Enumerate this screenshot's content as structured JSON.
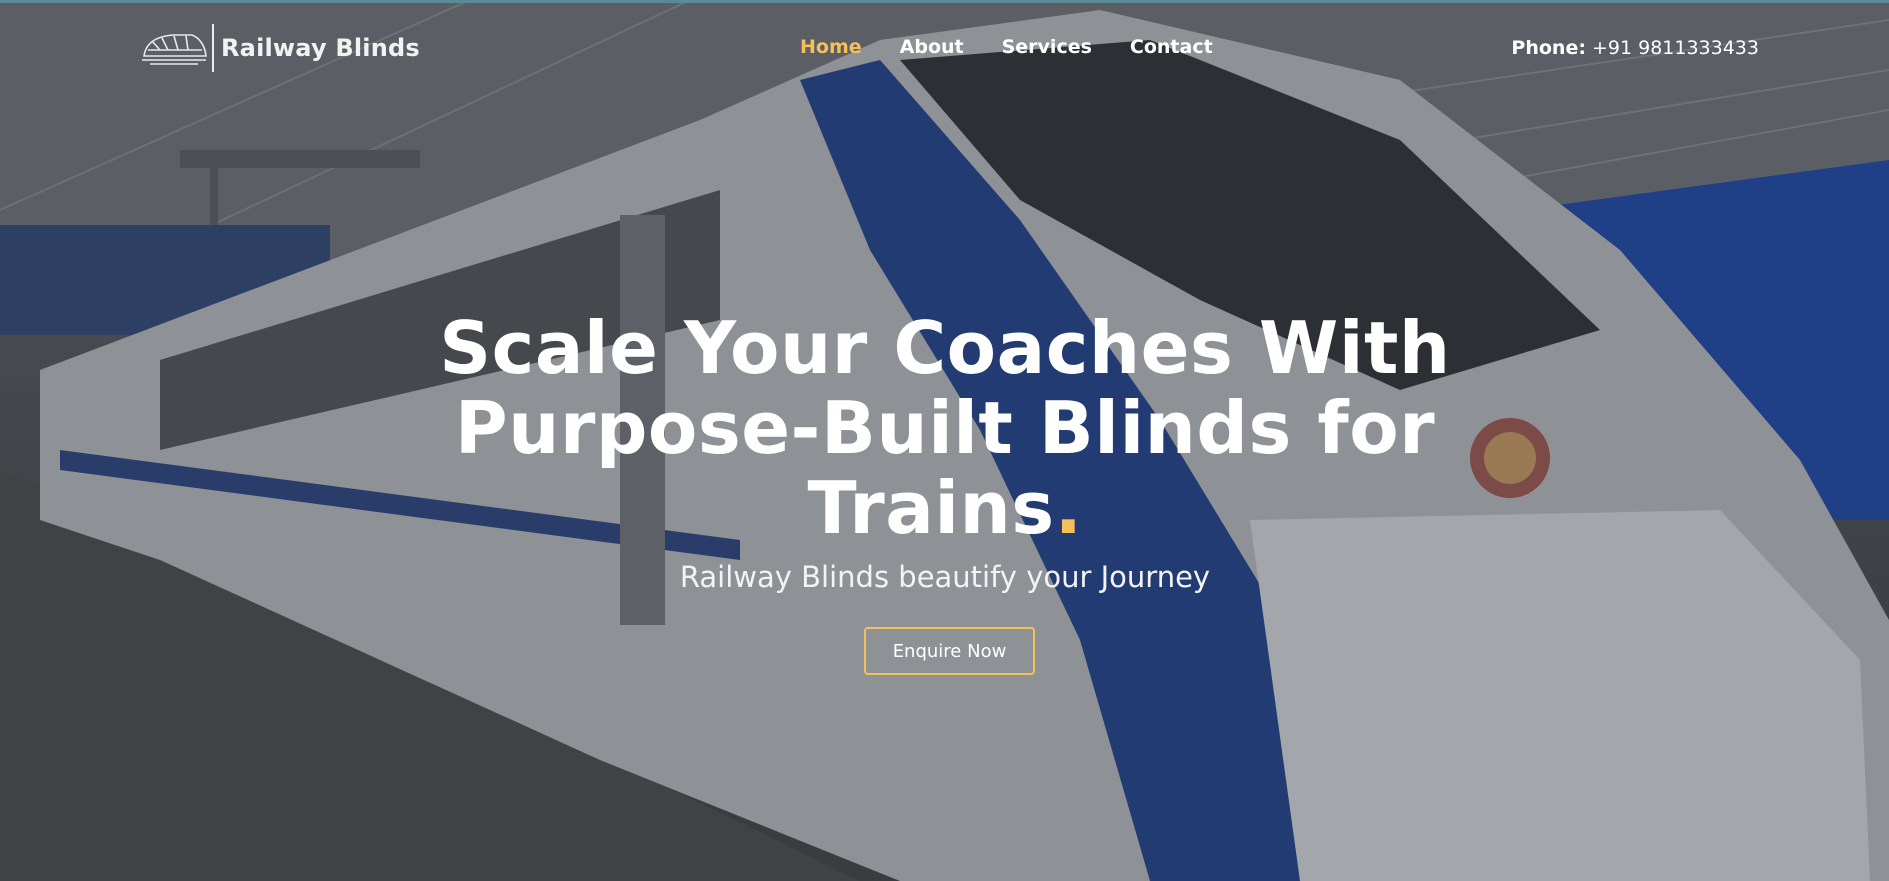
{
  "brand": {
    "name": "Railway Blinds"
  },
  "nav": {
    "items": [
      {
        "label": "Home",
        "active": true
      },
      {
        "label": "About",
        "active": false
      },
      {
        "label": "Services",
        "active": false
      },
      {
        "label": "Contact",
        "active": false
      }
    ]
  },
  "contact": {
    "phone_label": "Phone:",
    "phone_number": "+91 9811333433"
  },
  "hero": {
    "headline_line1": "Scale Your Coaches With",
    "headline_line2": "Purpose-Built Blinds for",
    "headline_line3": "Trains",
    "headline_dot": ".",
    "tagline": "Railway Blinds beautify your Journey",
    "cta_label": "Enquire Now"
  },
  "colors": {
    "accent": "#f5c05a",
    "text": "#ffffff",
    "overlay": "#3a3d42"
  },
  "icons": {
    "logo": "train-icon"
  }
}
